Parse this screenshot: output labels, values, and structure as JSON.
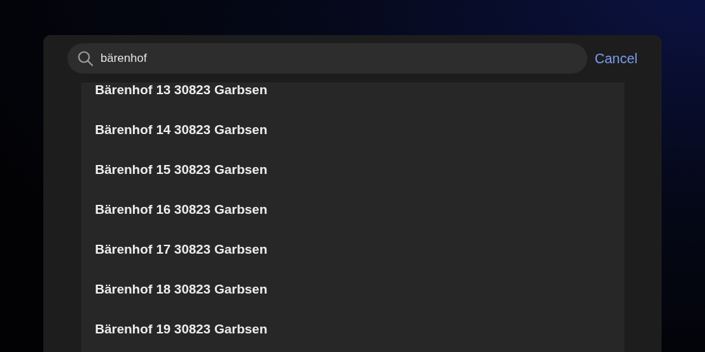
{
  "search": {
    "value": "bärenhof",
    "cancel": "Cancel"
  },
  "results": [
    {
      "label": "Bärenhof 13 30823 Garbsen"
    },
    {
      "label": "Bärenhof 14 30823 Garbsen"
    },
    {
      "label": "Bärenhof 15 30823 Garbsen"
    },
    {
      "label": "Bärenhof 16 30823 Garbsen"
    },
    {
      "label": "Bärenhof 17 30823 Garbsen"
    },
    {
      "label": "Bärenhof 18 30823 Garbsen"
    },
    {
      "label": "Bärenhof 19 30823 Garbsen"
    }
  ]
}
